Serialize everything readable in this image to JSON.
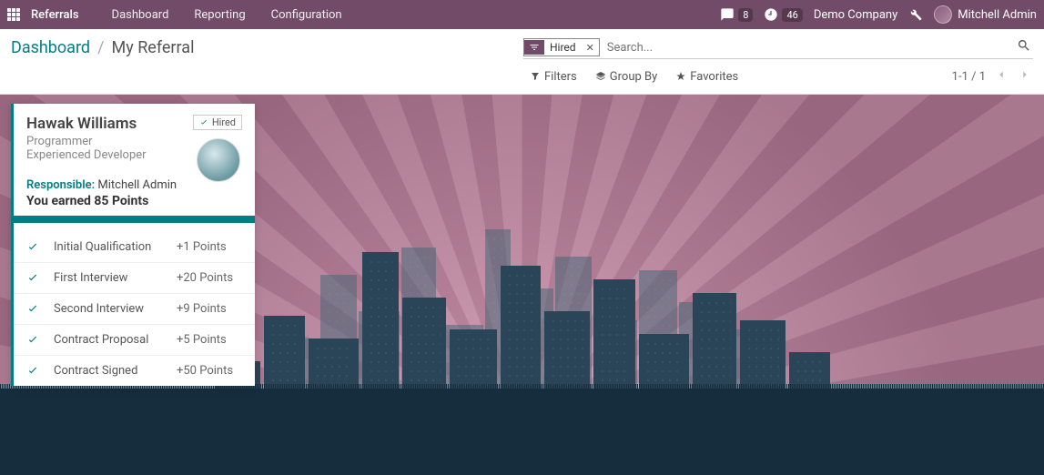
{
  "topbar": {
    "app_name": "Referrals",
    "nav": [
      "Dashboard",
      "Reporting",
      "Configuration"
    ],
    "chat_count": "8",
    "timer_count": "46",
    "company": "Demo Company",
    "user": "Mitchell Admin"
  },
  "breadcrumb": {
    "parent": "Dashboard",
    "current": "My Referral"
  },
  "search": {
    "filter_label": "Hired",
    "placeholder": "Search..."
  },
  "tools": {
    "filters": "Filters",
    "group_by": "Group By",
    "favorites": "Favorites"
  },
  "pager": {
    "text": "1-1 / 1"
  },
  "card": {
    "name": "Hawak Williams",
    "role": "Programmer",
    "subtitle": "Experienced Developer",
    "hired_badge": "Hired",
    "responsible_label": "Responsible:",
    "responsible_value": "Mitchell Admin",
    "earned": "You earned 85 Points",
    "stages": [
      {
        "name": "Initial Qualification",
        "points": "+1 Points"
      },
      {
        "name": "First Interview",
        "points": "+20 Points"
      },
      {
        "name": "Second Interview",
        "points": "+9 Points"
      },
      {
        "name": "Contract Proposal",
        "points": "+5 Points"
      },
      {
        "name": "Contract Signed",
        "points": "+50 Points"
      }
    ]
  }
}
